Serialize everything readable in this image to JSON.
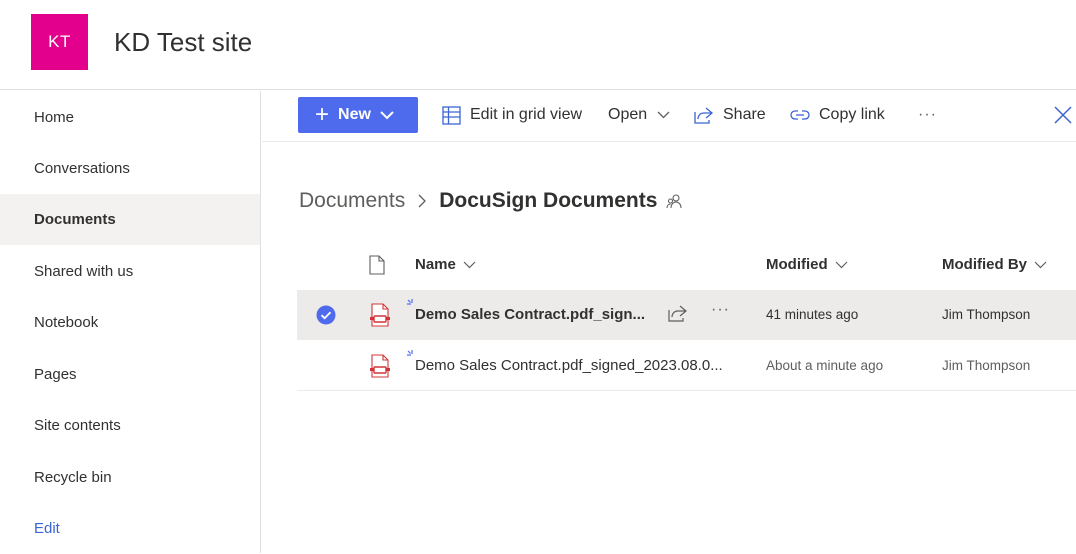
{
  "site": {
    "logo_initials": "KT",
    "logo_color": "#e3008c",
    "title": "KD Test site"
  },
  "sidebar": {
    "items": [
      {
        "label": "Home"
      },
      {
        "label": "Conversations"
      },
      {
        "label": "Documents",
        "selected": true
      },
      {
        "label": "Shared with us"
      },
      {
        "label": "Notebook"
      },
      {
        "label": "Pages"
      },
      {
        "label": "Site contents"
      },
      {
        "label": "Recycle bin"
      },
      {
        "label": "Edit",
        "link": true
      }
    ]
  },
  "commandbar": {
    "new_label": "New",
    "new_color": "#4f6bed",
    "edit_grid_label": "Edit in grid view",
    "open_label": "Open",
    "share_label": "Share",
    "copy_link_label": "Copy link",
    "more_label": "···"
  },
  "breadcrumb": {
    "parent": "Documents",
    "current": "DocuSign Documents"
  },
  "list": {
    "columns": {
      "name": "Name",
      "modified": "Modified",
      "modified_by": "Modified By"
    },
    "rows": [
      {
        "name": "Demo Sales Contract.pdf_sign...",
        "modified": "41 minutes ago",
        "modified_by": "Jim Thompson",
        "selected": true,
        "more": "···"
      },
      {
        "name": "Demo Sales Contract.pdf_signed_2023.08.0...",
        "modified": "About a minute ago",
        "modified_by": "Jim Thompson",
        "selected": false
      }
    ]
  },
  "icons": {
    "pdf_color": "#d13438",
    "accent": "#4f6bed",
    "link_color": "#3b65d4"
  }
}
